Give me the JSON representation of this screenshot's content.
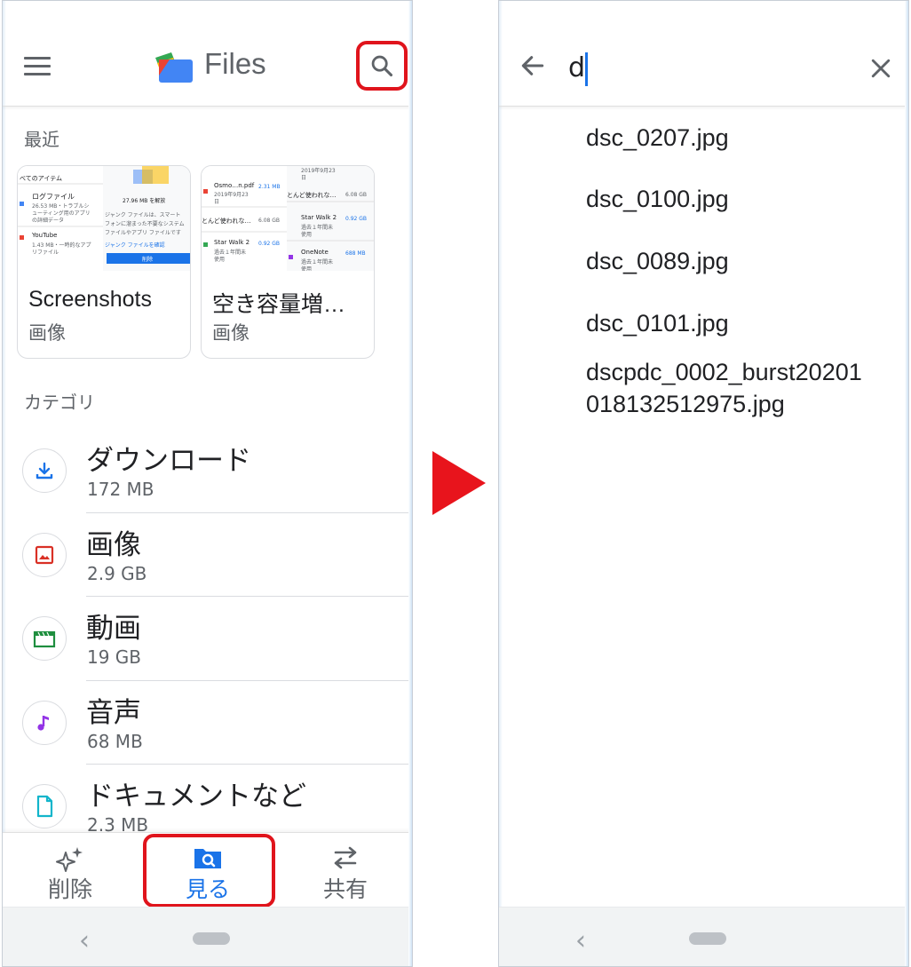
{
  "left": {
    "header": {
      "title": "Files"
    },
    "recent": {
      "label": "最近",
      "cards": [
        {
          "title": "Screenshots",
          "subtitle": "画像",
          "thumb": {
            "title": "べてのアイテム",
            "l1": "ログファイル",
            "l2": "26.53 MB・トラブルシ",
            "l3": "ューティング用のアプリ",
            "l4": "の詳細データ",
            "l5": "YouTube",
            "l6": "1.43 MB・一時的なアプ",
            "l7": "リファイル",
            "r1": "27.96 MB を解放",
            "r2": "ジャンク ファイルは、スマート",
            "r3": "フォンに溜まった不要なシステム",
            "r4": "ファイルやアプリ ファイルです",
            "r5": "ジャンク ファイルを確認",
            "r6": "削除"
          }
        },
        {
          "title": "空き容量増…",
          "subtitle": "画像",
          "thumb": {
            "a1": "Osmo…n.pdf",
            "a2": "2019年9月23",
            "a3": "日",
            "a4": "2.31 MB",
            "a5": "2019年9月23",
            "a6": "日",
            "b1": "とんど使われな…",
            "b2": "6.08 GB",
            "b3": "とんど使われな…",
            "b4": "6.08 GB",
            "c1": "Star Walk 2",
            "c2": "過去１年間未",
            "c3": "使用",
            "c4": "0.92 GB",
            "c5": "Star Walk 2",
            "c6": "過去１年間未",
            "c7": "使用",
            "c8": "0.92 GB",
            "d1": "OneNote",
            "d2": "過去１年間未",
            "d3": "使用",
            "d4": "688 MB"
          }
        }
      ]
    },
    "categories": {
      "label": "カテゴリ",
      "items": [
        {
          "name": "ダウンロード",
          "size": "172 MB",
          "icon": "download-icon",
          "color": "#1a73e8"
        },
        {
          "name": "画像",
          "size": "2.9 GB",
          "icon": "image-icon",
          "color": "#d93025"
        },
        {
          "name": "動画",
          "size": "19 GB",
          "icon": "video-icon",
          "color": "#1e8e3e"
        },
        {
          "name": "音声",
          "size": "68 MB",
          "icon": "music-icon",
          "color": "#9334e6"
        },
        {
          "name": "ドキュメントなど",
          "size": "2.3 MB",
          "icon": "document-icon",
          "color": "#12b5cb"
        }
      ]
    },
    "bottom_nav": [
      {
        "label": "削除",
        "icon": "sparkle-icon",
        "active": false
      },
      {
        "label": "見る",
        "icon": "browse-folder-icon",
        "active": true
      },
      {
        "label": "共有",
        "icon": "swap-arrows-icon",
        "active": false
      }
    ]
  },
  "right": {
    "search": {
      "query": "d"
    },
    "results": [
      "dsc_0207.jpg",
      "dsc_0100.jpg",
      "dsc_0089.jpg",
      "dsc_0101.jpg",
      "dscpdc_0002_burst20201018132512975.jpg"
    ]
  },
  "colors": {
    "highlight": "#e0141c",
    "accent": "#1a73e8"
  }
}
